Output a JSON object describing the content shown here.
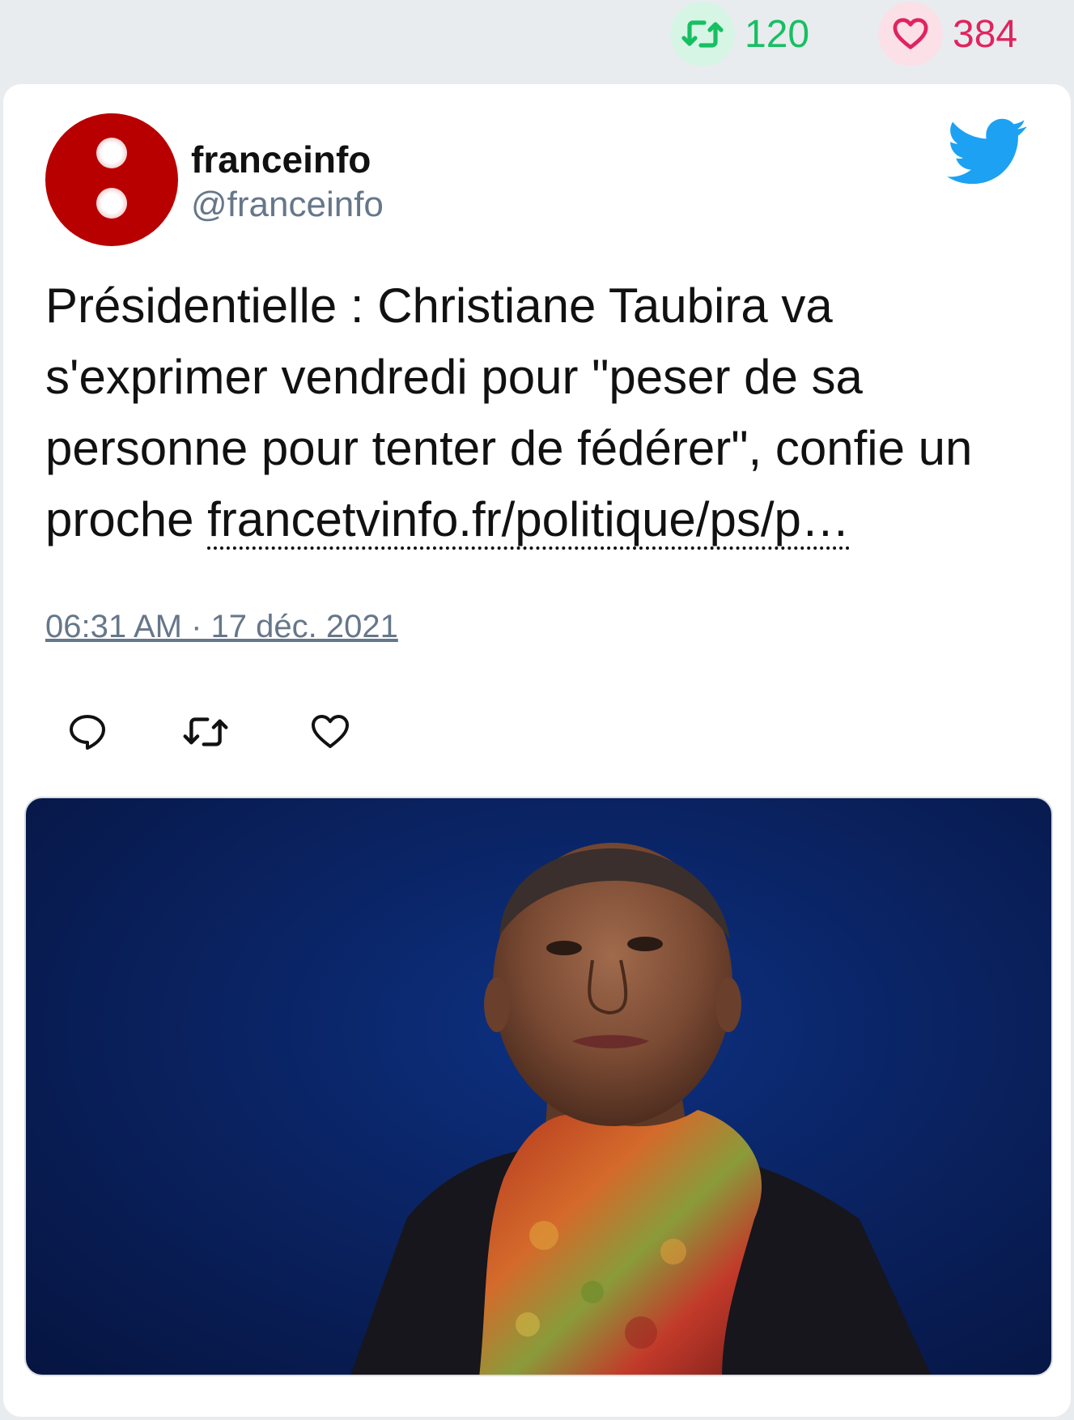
{
  "stats": {
    "retweets": "120",
    "likes": "384",
    "retweet_color": "#17bf63",
    "like_color": "#e0245e"
  },
  "author": {
    "name": "franceinfo",
    "handle": "@franceinfo",
    "avatar_color": "#b80000",
    "avatar_icon": "franceinfo-logo-icon"
  },
  "tweet": {
    "text": "Présidentielle : Christiane Taubira va s'exprimer vendredi pour \"peser de sa personne pour tenter de fédérer\", confie un proche ",
    "link_text": "francetvinfo.fr/politique/ps/p…",
    "timestamp": "06:31 AM · 17 déc. 2021"
  },
  "actions": {
    "reply_icon": "reply-icon",
    "retweet_icon": "retweet-icon",
    "like_icon": "heart-icon"
  },
  "brand": {
    "icon": "twitter-bird-icon",
    "color": "#1da1f2"
  }
}
